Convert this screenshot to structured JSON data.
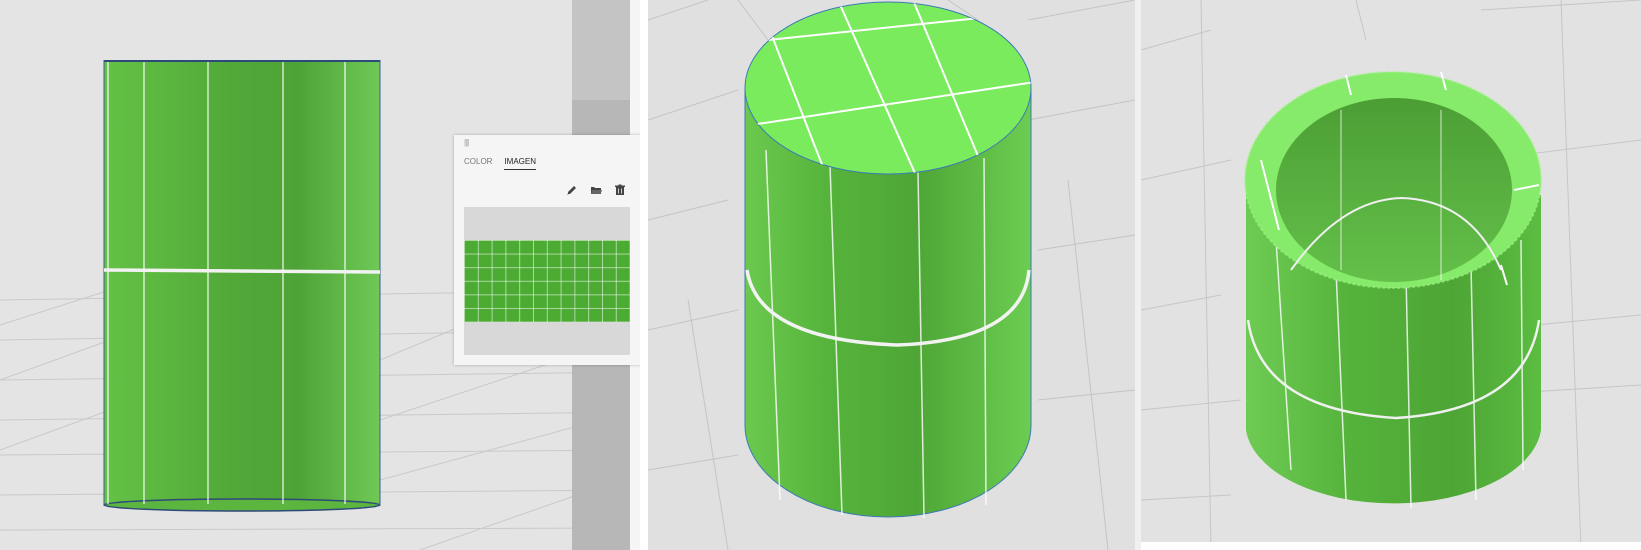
{
  "material_panel": {
    "tabs": [
      {
        "label": "COLOR",
        "active": false
      },
      {
        "label": "IMAGEN",
        "active": true
      }
    ],
    "tools": [
      "pencil-icon",
      "folder-open-icon",
      "trash-icon"
    ],
    "texture_color": "#4bab32"
  },
  "colors": {
    "cylinder_green": "#5cbf3f",
    "top_green": "#79eb5c",
    "floor_grey": "#e4e4e4"
  }
}
